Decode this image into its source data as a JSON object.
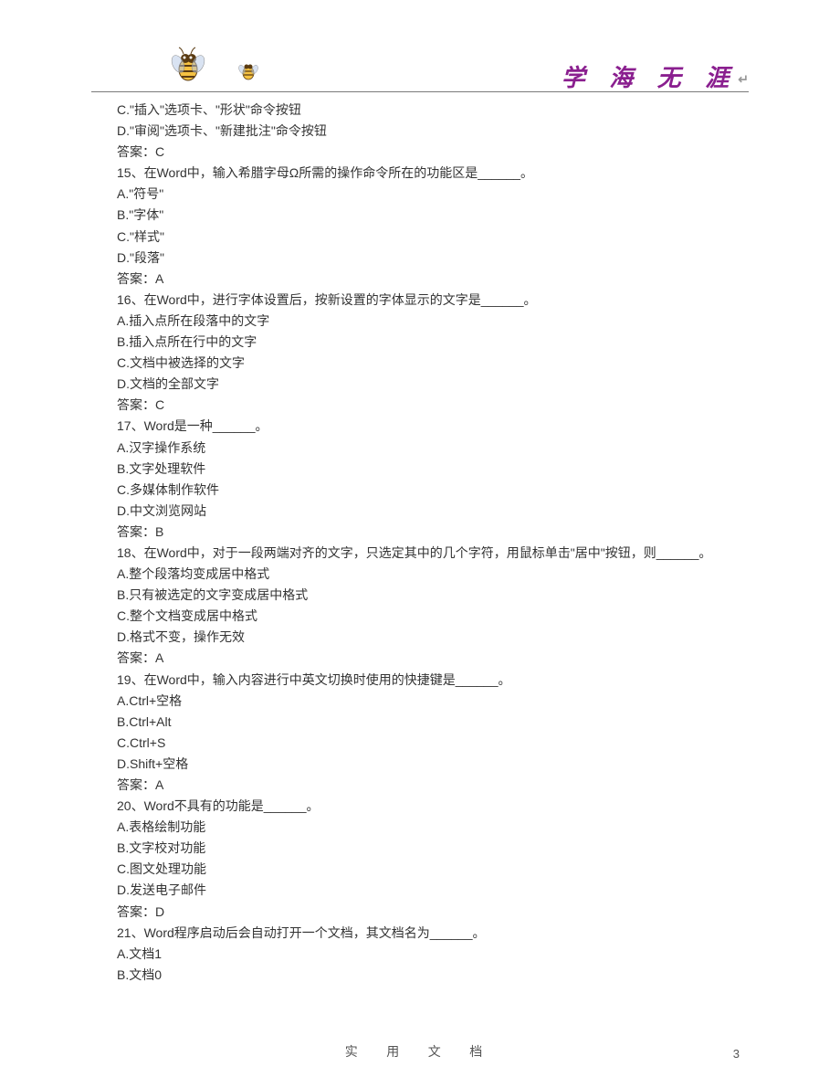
{
  "header": {
    "motto": "学 海 无 涯",
    "arrow": "↵"
  },
  "lines": [
    "C.\"插入\"选项卡、\"形状\"命令按钮",
    "D.\"审阅\"选项卡、\"新建批注\"命令按钮",
    "答案：C",
    "15、在Word中，输入希腊字母Ω所需的操作命令所在的功能区是______。",
    "A.\"符号\"",
    "B.\"字体\"",
    "C.\"样式\"",
    "D.\"段落\"",
    "答案：A",
    "16、在Word中，进行字体设置后，按新设置的字体显示的文字是______。",
    "A.插入点所在段落中的文字",
    "B.插入点所在行中的文字",
    "C.文档中被选择的文字",
    "D.文档的全部文字",
    "答案：C",
    "17、Word是一种______。",
    "A.汉字操作系统",
    "B.文字处理软件",
    "C.多媒体制作软件",
    "D.中文浏览网站",
    "答案：B",
    "18、在Word中，对于一段两端对齐的文字，只选定其中的几个字符，用鼠标单击\"居中\"按钮，则______。",
    "A.整个段落均变成居中格式",
    "B.只有被选定的文字变成居中格式",
    "C.整个文档变成居中格式",
    "D.格式不变，操作无效",
    "答案：A",
    "19、在Word中，输入内容进行中英文切换时使用的快捷键是______。",
    "A.Ctrl+空格",
    "B.Ctrl+Alt",
    "C.Ctrl+S",
    "D.Shift+空格",
    "答案：A",
    "20、Word不具有的功能是______。",
    "A.表格绘制功能",
    "B.文字校对功能",
    "C.图文处理功能",
    "D.发送电子邮件",
    "答案：D",
    "21、Word程序启动后会自动打开一个文档，其文档名为______。",
    "A.文档1",
    "B.文档0"
  ],
  "footer": {
    "text": "实 用 文 档",
    "page_number": "3"
  }
}
